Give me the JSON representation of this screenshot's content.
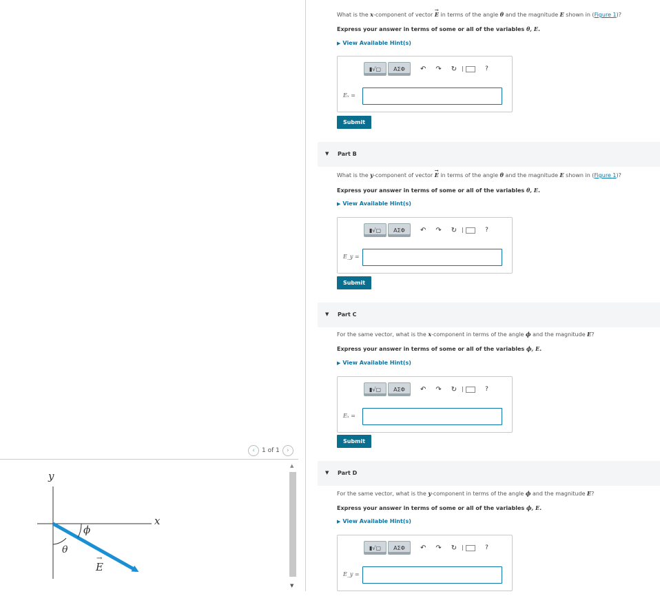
{
  "figure": {
    "pager_text": "1 of 1",
    "labels": {
      "y_axis": "y",
      "x_axis": "x",
      "phi": "ϕ",
      "theta": "θ",
      "vector": "E"
    },
    "colors": {
      "vector": "#1a8fd4",
      "axes": "#333333"
    }
  },
  "parts": [
    {
      "header": "",
      "question_pre": "What is the ",
      "question_var": "x",
      "question_mid": "-component of vector ",
      "question_vec": "E",
      "question_post": " in terms of the angle ",
      "question_angle": "θ",
      "question_mag_pre": " and the magnitude ",
      "question_mag": "E",
      "question_tail": " shown in (",
      "figure_link": "Figure 1",
      "question_end": ")?",
      "express_pre": "Express your answer in terms of some or all of the variables ",
      "express_vars": "θ, E",
      "express_end": ".",
      "hint": "View Available Hint(s)",
      "var_label": "Eₓ =",
      "submit": "Submit"
    },
    {
      "header": "Part B",
      "question_pre": "What is the ",
      "question_var": "y",
      "question_mid": "-component of vector ",
      "question_vec": "E",
      "question_post": " in terms of the angle ",
      "question_angle": "θ",
      "question_mag_pre": " and the magnitude ",
      "question_mag": "E",
      "question_tail": " shown in (",
      "figure_link": "Figure 1",
      "question_end": ")?",
      "express_pre": "Express your answer in terms of some or all of the variables ",
      "express_vars": "θ, E",
      "express_end": ".",
      "hint": "View Available Hint(s)",
      "var_label": "E_y =",
      "submit": "Submit"
    },
    {
      "header": "Part C",
      "question_pre": "For the same vector, what is the ",
      "question_var": "x",
      "question_mid": "-component in terms of the angle ",
      "question_vec": "",
      "question_post": "",
      "question_angle": "ϕ",
      "question_mag_pre": " and the magnitude ",
      "question_mag": "E",
      "question_tail": "",
      "figure_link": "",
      "question_end": "?",
      "express_pre": "Express your answer in terms of some or all of the variables ",
      "express_vars": "ϕ, E",
      "express_end": ".",
      "hint": "View Available Hint(s)",
      "var_label": "Eₓ =",
      "submit": "Submit"
    },
    {
      "header": "Part D",
      "question_pre": "For the same vector, what is the ",
      "question_var": "y",
      "question_mid": "-component in terms of the angle ",
      "question_vec": "",
      "question_post": "",
      "question_angle": "ϕ",
      "question_mag_pre": " and the magnitude ",
      "question_mag": "E",
      "question_tail": "",
      "figure_link": "",
      "question_end": "?",
      "express_pre": "Express your answer in terms of some or all of the variables ",
      "express_vars": "ϕ, E",
      "express_end": ".",
      "hint": "View Available Hint(s)",
      "var_label": "E_y =",
      "submit": ""
    }
  ],
  "toolbar": {
    "template_label": "▮√▢",
    "greek_label": "ΑΣΦ",
    "undo_icon": "↶",
    "redo_icon": "↷",
    "reset_icon": "↻",
    "help_label": "?"
  },
  "pager_prev": "‹",
  "pager_next": "›",
  "collapse_icon": "▼"
}
